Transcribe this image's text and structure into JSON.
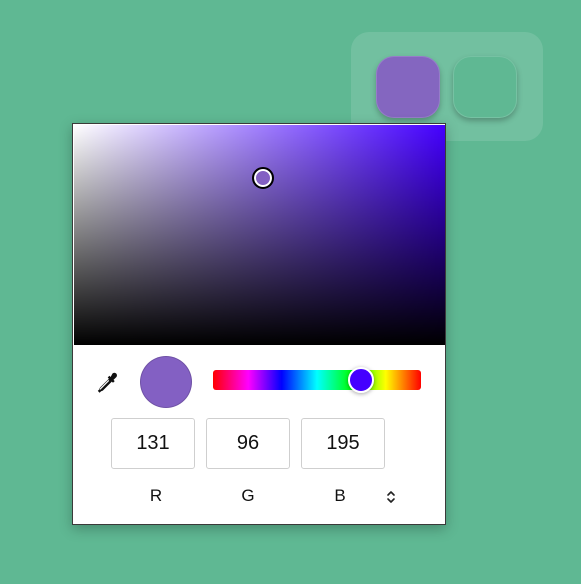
{
  "swatches": [
    {
      "name": "purple",
      "color": "#8466c0"
    },
    {
      "name": "green",
      "color": "#5fb893"
    }
  ],
  "picker": {
    "hue_color": "#4400ff",
    "selected_color": "#8360c3",
    "saturation": 0.51,
    "value": 0.76,
    "hue": 257,
    "fields": [
      {
        "label": "R",
        "value": "131"
      },
      {
        "label": "G",
        "value": "96"
      },
      {
        "label": "B",
        "value": "195"
      }
    ]
  }
}
